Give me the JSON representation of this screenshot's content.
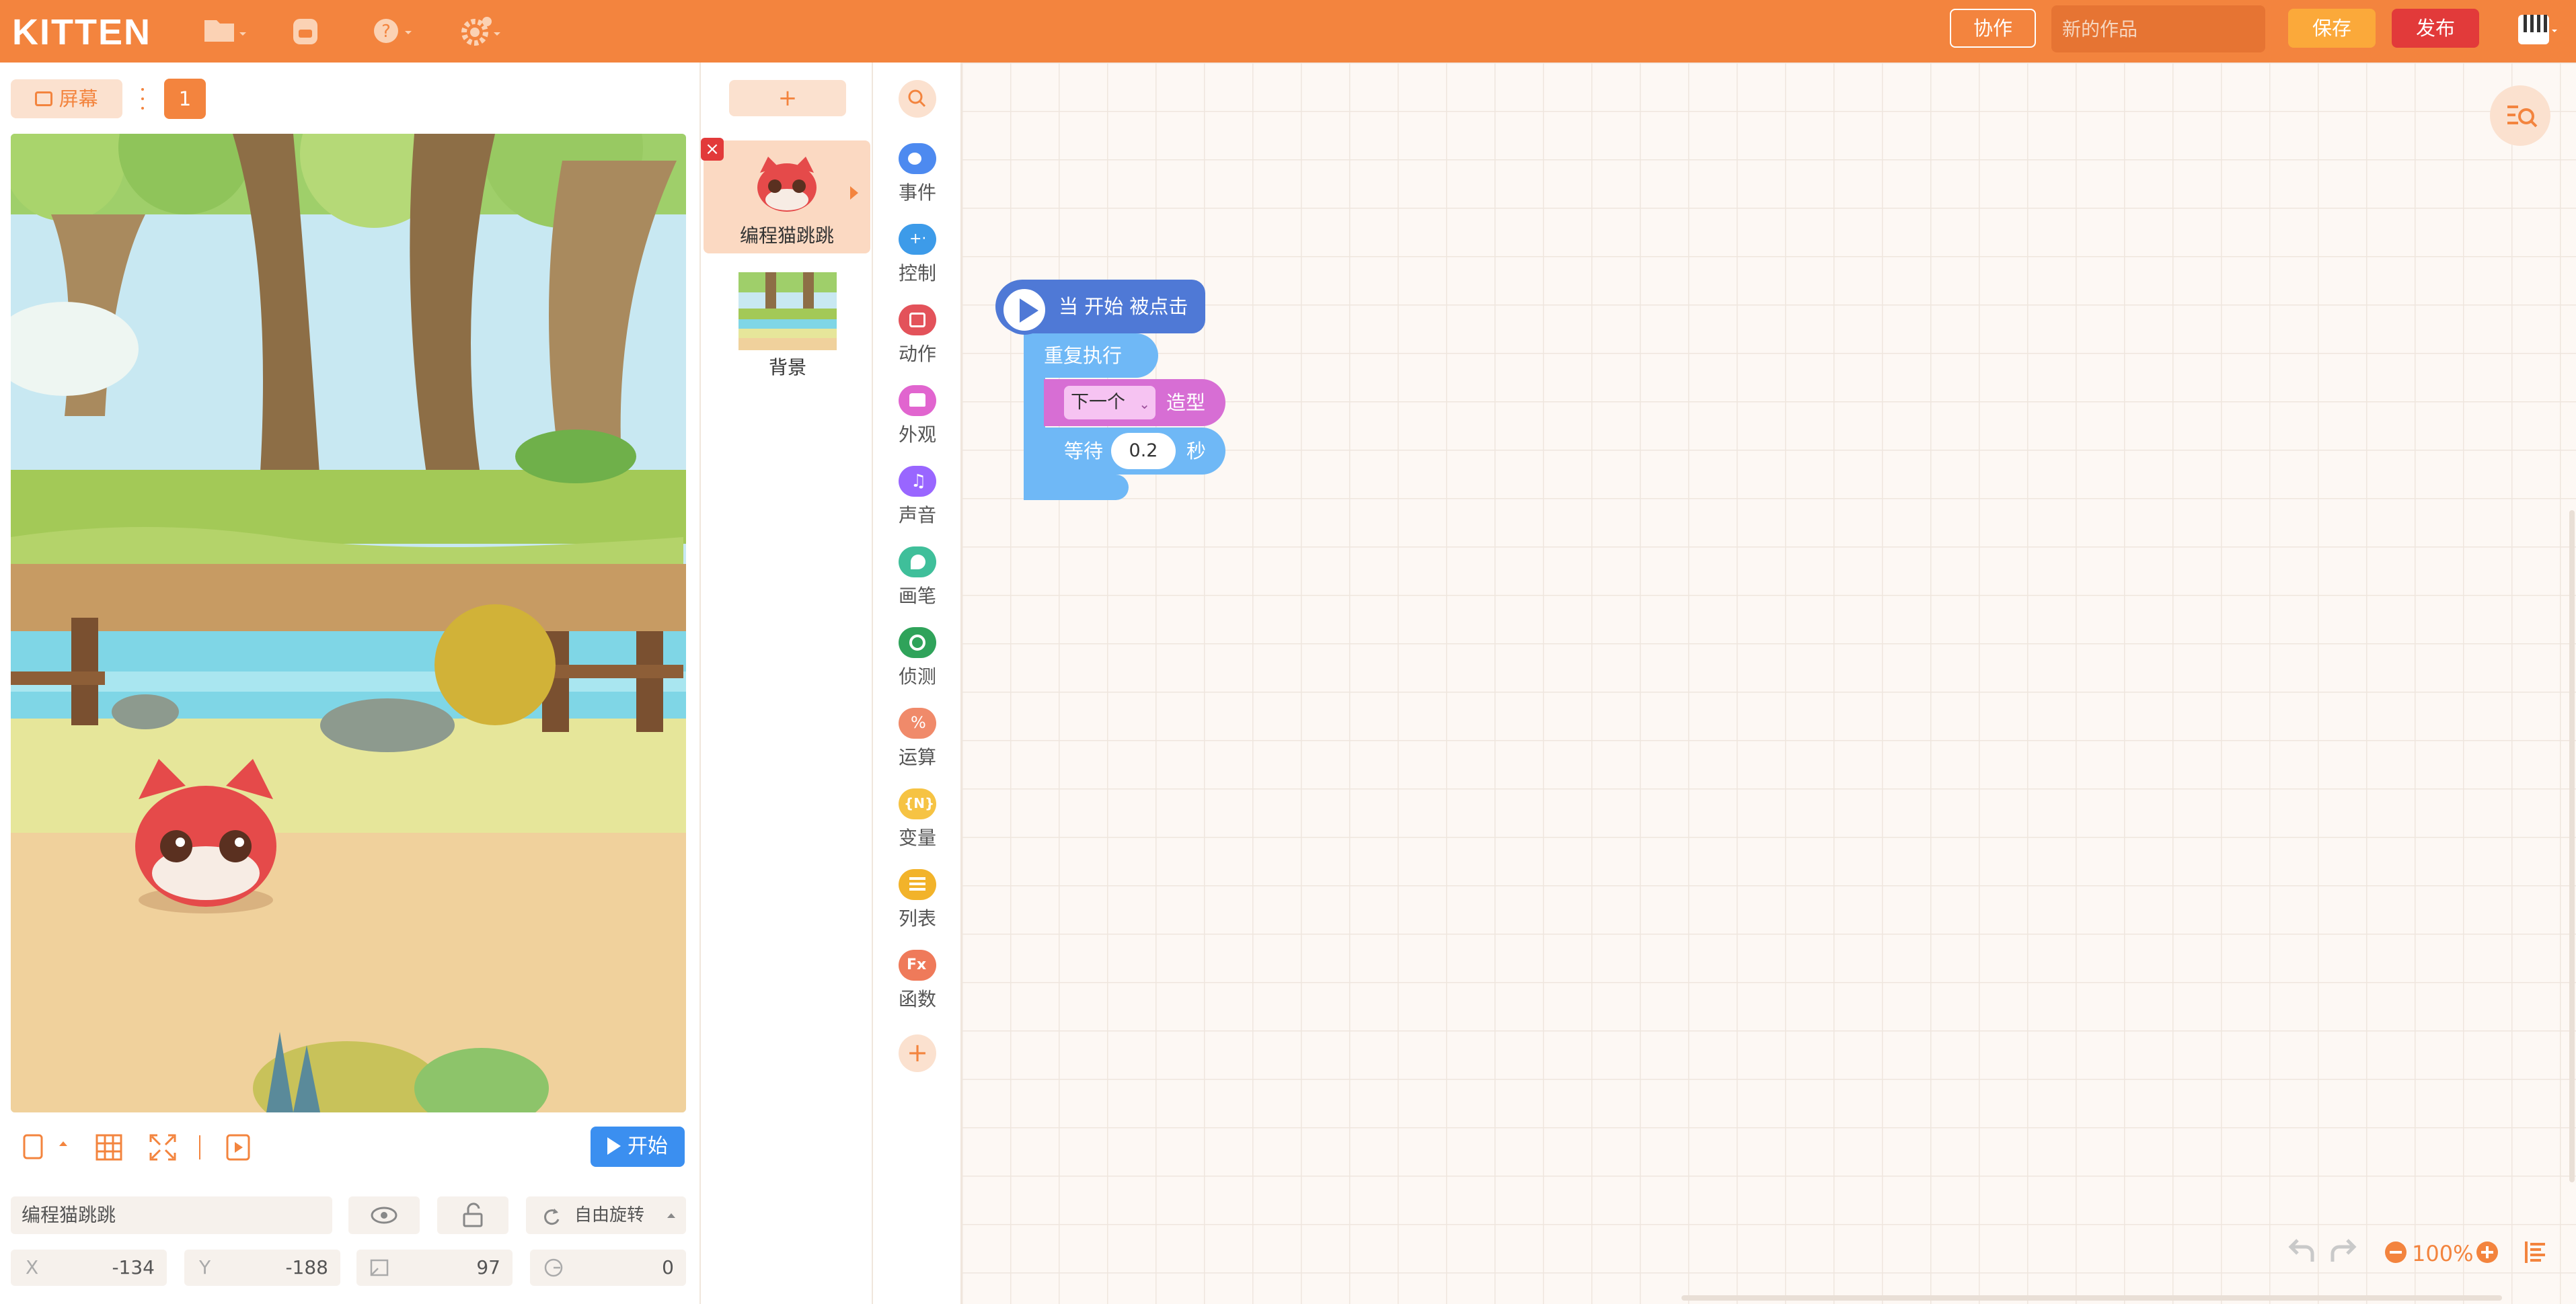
{
  "app": {
    "logo": "KITTEN"
  },
  "topbar": {
    "collab_label": "协作",
    "title_placeholder": "新的作品",
    "save_label": "保存",
    "publish_label": "发布",
    "icons": [
      "folder-icon",
      "backpack-icon",
      "help-icon",
      "settings-icon",
      "piano-icon"
    ]
  },
  "stage_panel": {
    "screen_label": "屏幕",
    "scene_number": "1",
    "start_label": "开始",
    "sprite_name": "编程猫跳跳",
    "rotation_mode": "自由旋转",
    "x_label": "X",
    "x_value": "-134",
    "y_label": "Y",
    "y_value": "-188",
    "size_value": "97",
    "direction_value": "0"
  },
  "sprites": {
    "add_label": "+",
    "items": [
      {
        "name": "编程猫跳跳"
      },
      {
        "name": "背景"
      }
    ]
  },
  "categories": [
    {
      "name": "事件",
      "color": "#4d8af0"
    },
    {
      "name": "控制",
      "color": "#3d9be9"
    },
    {
      "name": "动作",
      "color": "#e3525a"
    },
    {
      "name": "外观",
      "color": "#e165cf"
    },
    {
      "name": "声音",
      "color": "#9966ff"
    },
    {
      "name": "画笔",
      "color": "#3fbf9a"
    },
    {
      "name": "侦测",
      "color": "#2fa35a"
    },
    {
      "name": "运算",
      "color": "#f08a6a"
    },
    {
      "name": "变量",
      "color": "#f6c343"
    },
    {
      "name": "列表",
      "color": "#f2b32a"
    },
    {
      "name": "函数",
      "color": "#ef7a5a"
    }
  ],
  "workspace": {
    "blocks": {
      "hat": "当 开始 被点击",
      "repeat": "重复执行",
      "costume_select": "下一个",
      "costume_label": "造型",
      "wait_label": "等待",
      "wait_value": "0.2",
      "wait_unit": "秒"
    },
    "zoom": "100%"
  }
}
